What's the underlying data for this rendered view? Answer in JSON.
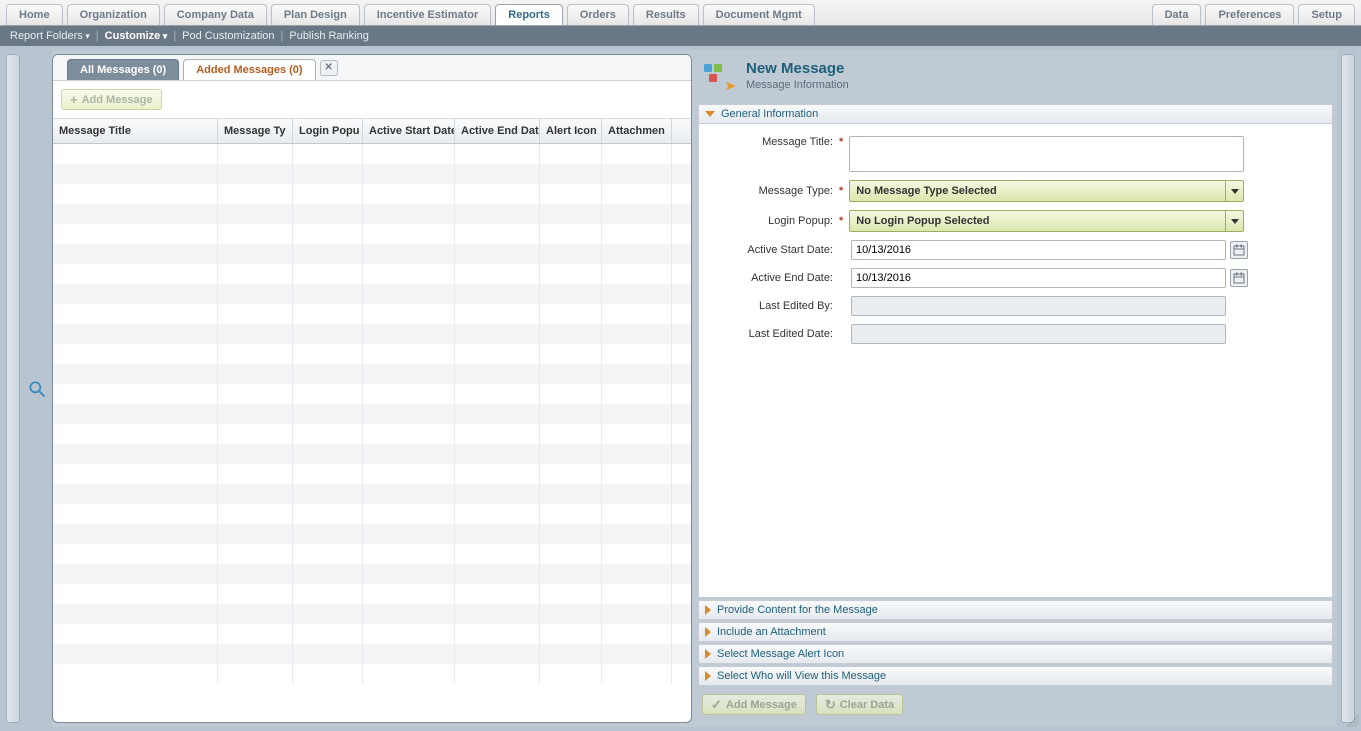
{
  "top_tabs_left": [
    {
      "label": "Home"
    },
    {
      "label": "Organization"
    },
    {
      "label": "Company Data"
    },
    {
      "label": "Plan Design"
    },
    {
      "label": "Incentive Estimator"
    },
    {
      "label": "Reports",
      "active": true
    },
    {
      "label": "Orders"
    },
    {
      "label": "Results"
    },
    {
      "label": "Document Mgmt"
    }
  ],
  "top_tabs_right": [
    {
      "label": "Data"
    },
    {
      "label": "Preferences"
    },
    {
      "label": "Setup"
    }
  ],
  "subnav": {
    "report_folders": "Report Folders",
    "customize": "Customize",
    "pod_customization": "Pod Customization",
    "publish_ranking": "Publish Ranking"
  },
  "grid": {
    "tab_all": "All Messages (0)",
    "tab_added": "Added Messages (0)",
    "add_btn": "Add Message",
    "cols": {
      "title": "Message Title",
      "type": "Message Ty",
      "login": "Login Popu",
      "start": "Active Start Date",
      "end": "Active End Dat",
      "alert": "Alert Icon",
      "attach": "Attachmen"
    }
  },
  "form": {
    "title": "New Message",
    "subtitle": "Message Information",
    "section_general": "General Information",
    "labels": {
      "msg_title": "Message Title:",
      "msg_type": "Message Type:",
      "login_popup": "Login Popup:",
      "active_start": "Active Start Date:",
      "active_end": "Active End Date:",
      "last_by": "Last Edited By:",
      "last_date": "Last Edited Date:"
    },
    "values": {
      "msg_title": "",
      "msg_type": "No Message Type Selected",
      "login_popup": "No Login Popup Selected",
      "active_start": "10/13/2016",
      "active_end": "10/13/2016",
      "last_by": "",
      "last_date": ""
    },
    "collapsed_sections": [
      "Provide Content for the Message",
      "Include an Attachment",
      "Select Message Alert Icon",
      "Select Who will View this Message"
    ],
    "actions": {
      "add": "Add Message",
      "clear": "Clear Data"
    }
  }
}
